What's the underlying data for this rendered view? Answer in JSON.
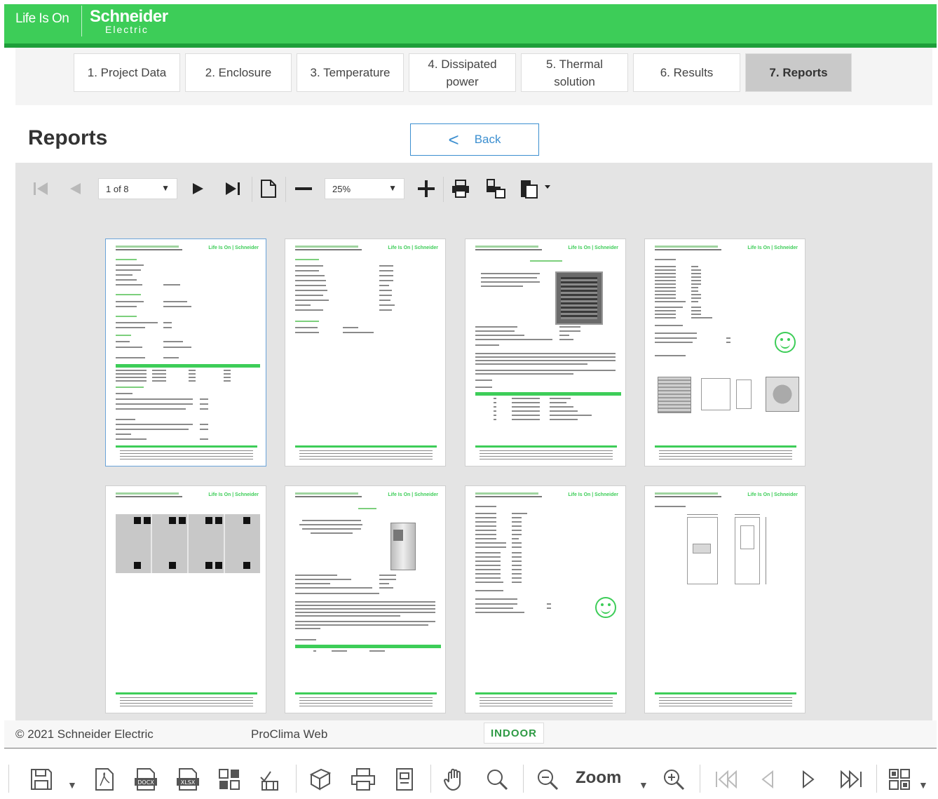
{
  "header": {
    "tagline": "Life Is On",
    "brand": "Schneider",
    "brand_sub": "Electric"
  },
  "steps": [
    {
      "label": "1. Project Data"
    },
    {
      "label": "2. Enclosure"
    },
    {
      "label": "3. Temperature"
    },
    {
      "label": "4. Dissipated power"
    },
    {
      "label": "5. Thermal solution"
    },
    {
      "label": "6. Results"
    },
    {
      "label": "7. Reports",
      "active": true
    }
  ],
  "page": {
    "title": "Reports",
    "back_label": "Back",
    "back_arrow": "<"
  },
  "viewer_toolbar": {
    "page_select": "1 of 8",
    "zoom_select": "25%",
    "icons": [
      "first-page-icon",
      "prev-page-icon",
      "next-page-icon",
      "last-page-icon",
      "single-page-icon",
      "zoom-out-icon",
      "zoom-in-icon",
      "print-icon",
      "print-page-icon",
      "export-icon"
    ]
  },
  "footer": {
    "copyright": "© 2021 Schneider Electric",
    "app": "ProClima Web",
    "mode_badge": "INDOOR"
  },
  "bottom_toolbar": {
    "zoom_label": "Zoom",
    "icons": [
      "save-icon",
      "pdf-icon",
      "docx-icon",
      "xlsx-icon",
      "layout-icon",
      "checklist-icon",
      "pages-icon",
      "print-icon",
      "document-icon",
      "hand-icon",
      "search-icon",
      "zoom-out-icon",
      "zoom-in-icon",
      "first-icon",
      "prev-icon",
      "next-icon",
      "last-icon",
      "multipage-icon"
    ]
  },
  "colors": {
    "brand_green": "#3dcd58",
    "link_blue": "#3c8fd0",
    "active_step": "#c9c9c9"
  }
}
